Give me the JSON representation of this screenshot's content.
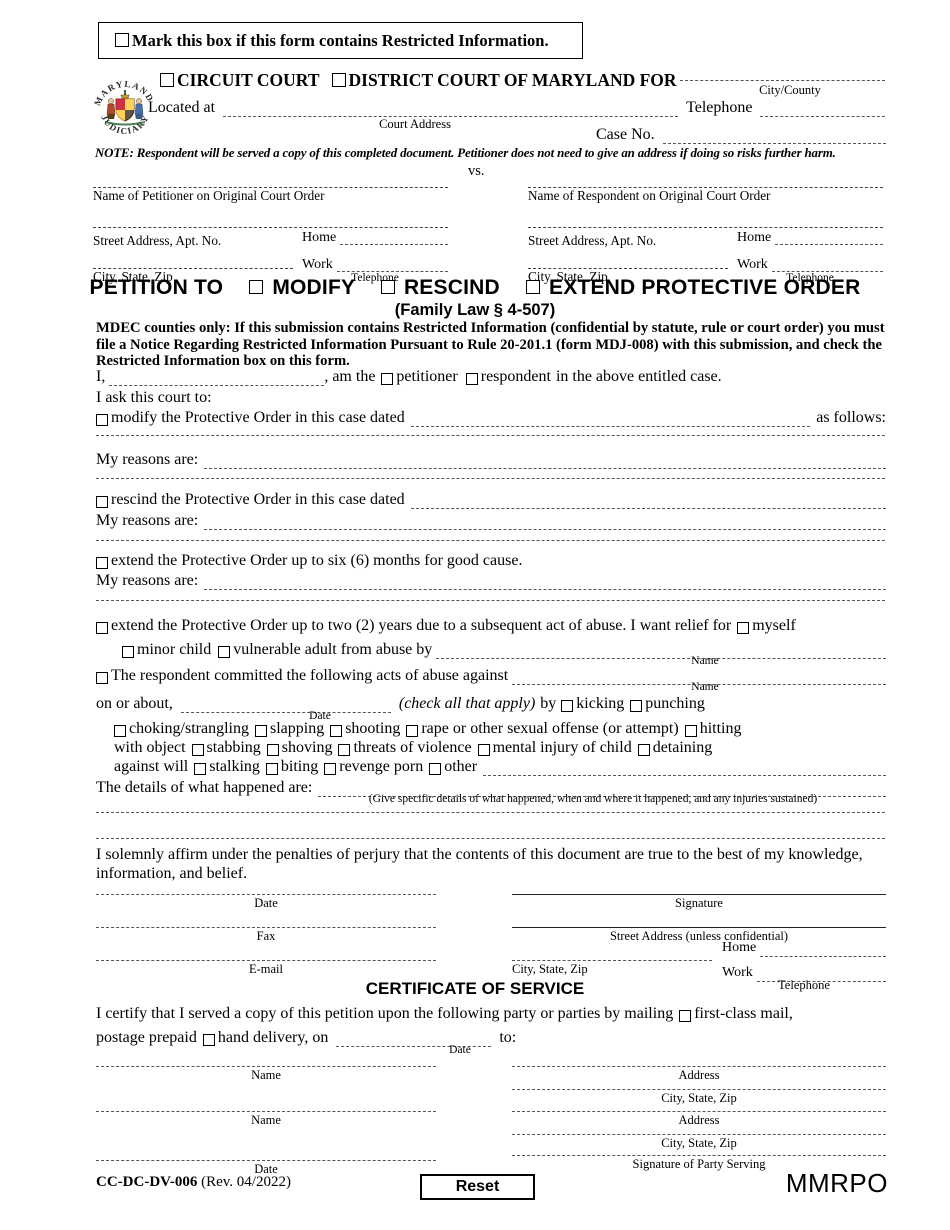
{
  "restricted": {
    "label": "Mark this box if this form contains Restricted Information."
  },
  "header": {
    "circuit_court": "CIRCUIT COURT",
    "district_court": "DISTRICT COURT OF MARYLAND FOR",
    "city_county_caption": "City/County",
    "located_at": "Located at",
    "court_address_caption": "Court Address",
    "telephone": "Telephone",
    "case_no": "Case No.",
    "note": "NOTE: Respondent will be served a copy of this completed document.  Petitioner does not need to give an address if doing so risks further harm.",
    "seal_top_text": "MARYLAND",
    "seal_bottom_text": "JUDICIARY"
  },
  "parties": {
    "vs": "vs.",
    "petitioner": {
      "name_caption": "Name of Petitioner on Original Court Order",
      "street_caption": "Street Address, Apt. No.",
      "city_caption": "City, State, Zip",
      "home_label": "Home",
      "work_label": "Work",
      "telephone_caption": "Telephone"
    },
    "respondent": {
      "name_caption": "Name of Respondent on Original Court Order",
      "street_caption": "Street Address, Apt. No.",
      "city_caption": "City, State, Zip",
      "home_label": "Home",
      "work_label": "Work",
      "telephone_caption": "Telephone"
    }
  },
  "title": {
    "petition_to": "PETITION TO",
    "modify": "MODIFY",
    "rescind": "RESCIND",
    "extend": "EXTEND PROTECTIVE ORDER",
    "statute": "(Family Law § 4-507)"
  },
  "mdec_notice": "MDEC counties only: If this submission contains Restricted Information (confidential by statute, rule or court order) you must file a Notice Regarding Restricted Information Pursuant to Rule 20-201.1 (form MDJ-008) with this submission, and check the Restricted Information box on this form.",
  "body": {
    "i_am": {
      "pre": "I,",
      "mid": ", am the",
      "petitioner": "petitioner",
      "respondent": "respondent",
      "post": "in the above entitled case."
    },
    "ask_court": "I ask this court to:",
    "modify_line": {
      "text": "modify the Protective Order in this case dated",
      "tail": "as follows:"
    },
    "my_reasons": "My reasons are:",
    "rescind_line": "rescind the Protective Order in this case dated",
    "extend_six_months": "extend the Protective Order up to six (6) months for good cause.",
    "extend_two_years": "extend the Protective Order up to two (2) years due to a subsequent act of abuse. I want relief for",
    "myself": "myself",
    "minor_child": "minor child",
    "vulnerable_adult": "vulnerable adult from abuse by",
    "name_caption": "Name",
    "respondent_committed": "The respondent committed the following acts of abuse against",
    "on_or_about": "on or about,",
    "date_caption": "Date",
    "check_all": "(check all that apply)",
    "by": "by",
    "acts": [
      "kicking",
      "punching",
      "choking/strangling",
      "slapping",
      "shooting",
      "rape or other sexual offense (or attempt)",
      "hitting with object",
      "stabbing",
      "shoving",
      "threats of violence",
      "mental injury of child",
      "detaining against will",
      "stalking",
      "biting",
      "revenge porn",
      "other"
    ],
    "details_label": "The details of what happened are:",
    "details_caption": "(Give specific details of what happened, when and where it happened, and any injuries sustained)",
    "affirm": "I solemnly affirm under the penalties of perjury that the contents of this document are true to the best of my knowledge, information, and belief."
  },
  "signature_block": {
    "date": "Date",
    "signature": "Signature",
    "fax": "Fax",
    "street_address": "Street Address (unless confidential)",
    "email": "E-mail",
    "city_state_zip": "City, State, Zip",
    "home": "Home",
    "work": "Work",
    "telephone": "Telephone"
  },
  "certificate": {
    "heading": "CERTIFICATE OF SERVICE",
    "line1": "I certify that I served a copy of this petition upon the following party or parties by mailing",
    "first_class": "first-class mail,",
    "line2": "postage prepaid",
    "hand_delivery": "hand delivery, on",
    "date_caption": "Date",
    "to": "to:",
    "name_caption": "Name",
    "address_caption": "Address",
    "city_state_zip_caption": "City, State, Zip",
    "signature_party": "Signature of Party Serving",
    "date_caption2": "Date"
  },
  "footer": {
    "form_number": "CC-DC-DV-006",
    "revision": "(Rev. 04/2022)",
    "reset_label": "Reset",
    "code": "MMRPO"
  }
}
